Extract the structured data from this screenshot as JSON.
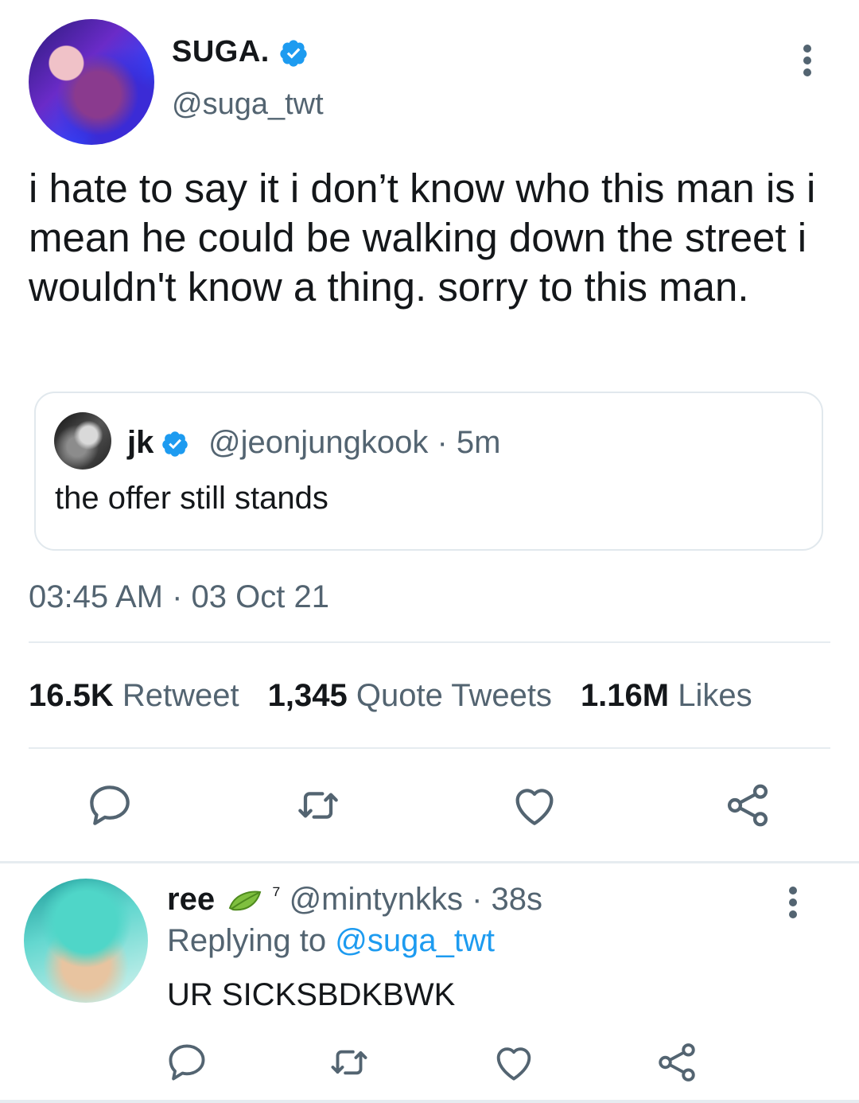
{
  "tweet": {
    "display_name": "SUGA.",
    "handle": "@suga_twt",
    "text": "i hate to say it i don’t know who this man is i mean he could be walking down the street i wouldn't know a thing. sorry to this man.",
    "avatar_icon": "user-avatar-photo",
    "verified_icon": "verified-badge-icon",
    "more_icon": "more-vertical-icon",
    "quote": {
      "display_name": "jk",
      "handle_time": "@jeonjungkook · 5m",
      "text": "the offer still stands"
    },
    "timestamp": "03:45 AM · 03 Oct 21",
    "stats": {
      "retweets_count": "16.5K",
      "retweets_label": "Retweet",
      "quotes_count": "1,345",
      "quotes_label": "Quote Tweets",
      "likes_count": "1.16M",
      "likes_label": "Likes"
    },
    "actions": [
      "reply-icon",
      "retweet-icon",
      "like-icon",
      "share-icon"
    ]
  },
  "reply": {
    "display_name": "ree",
    "name_suffix": "⁷",
    "handle_time": "@mintynkks · 38s",
    "replying_prefix": "Replying to",
    "replying_to": "@suga_twt",
    "text": "UR SICKSBDKBWK"
  },
  "colors": {
    "text": "#14171a",
    "secondary": "#536471",
    "accent": "#1d9bf0",
    "border": "#e1e8ed"
  }
}
